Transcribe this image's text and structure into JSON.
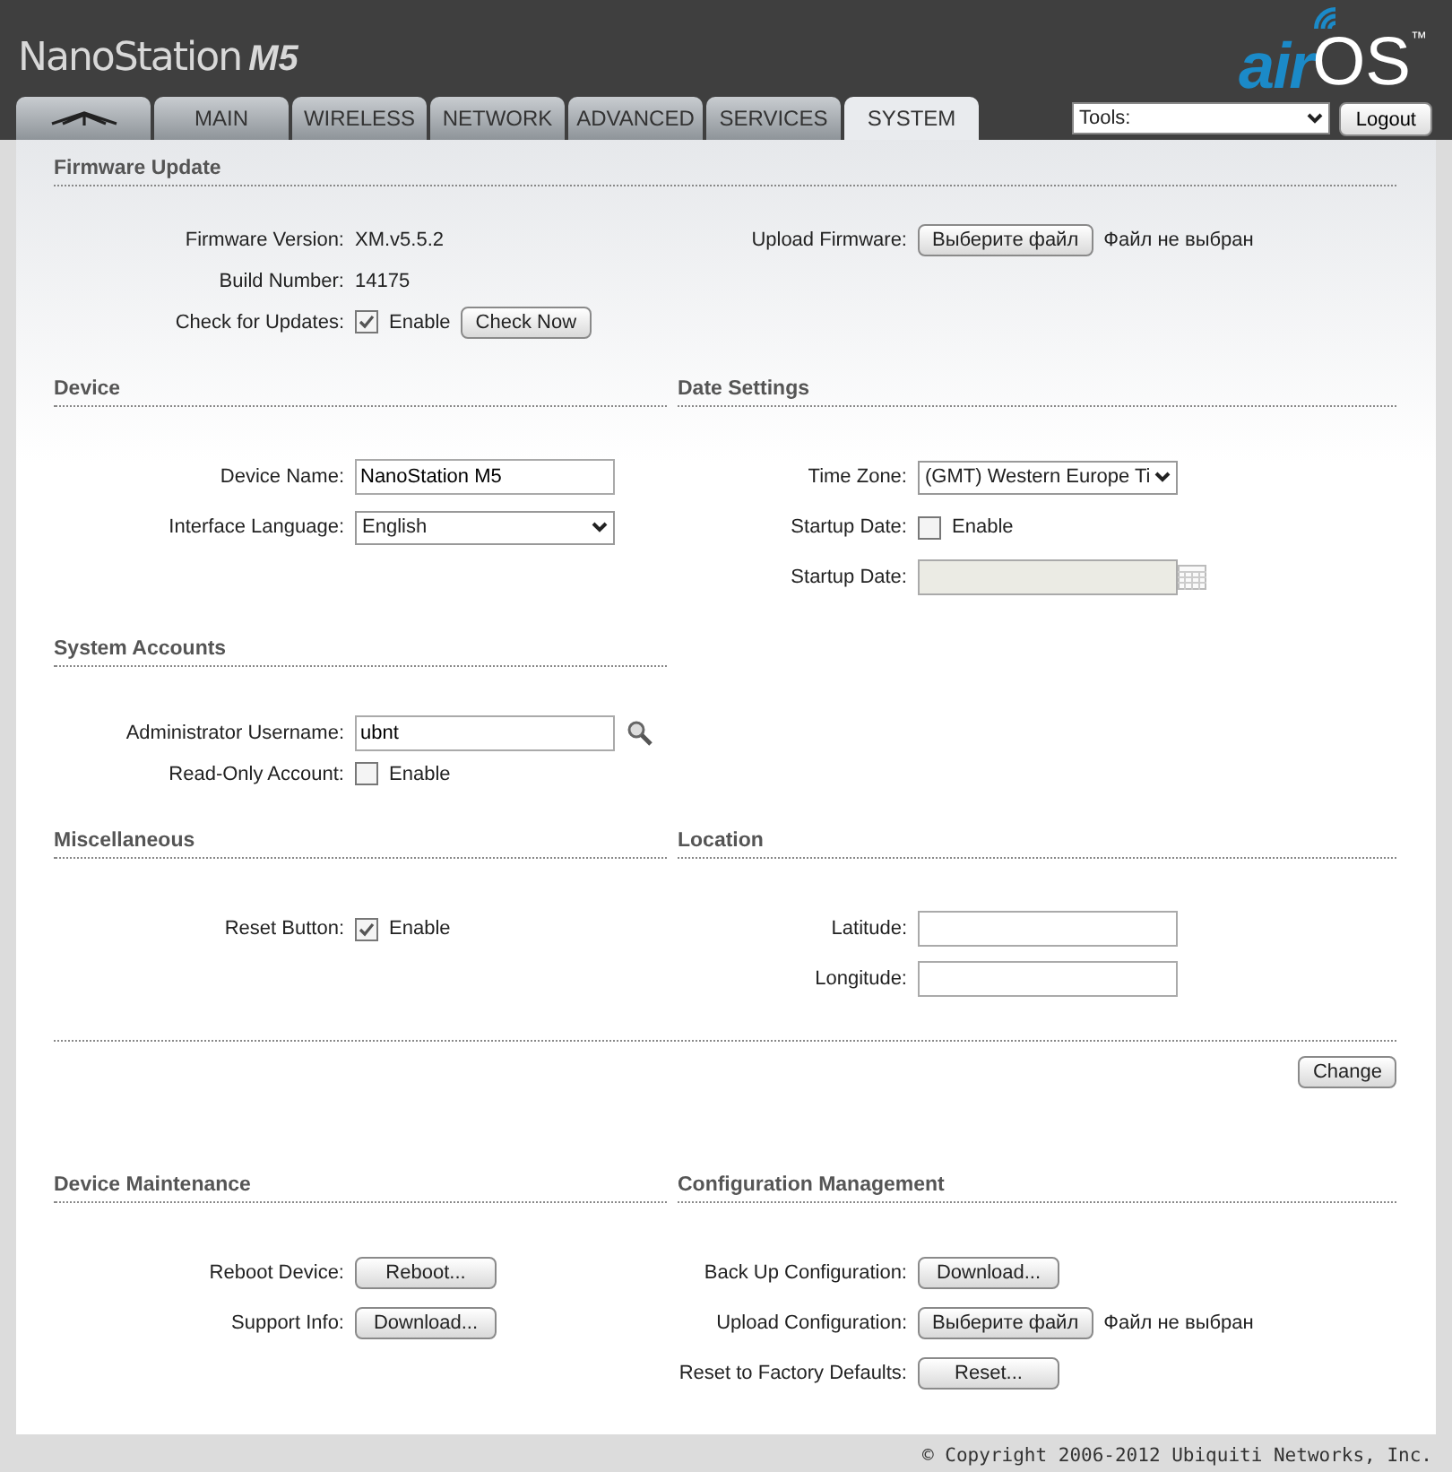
{
  "header": {
    "product": "NanoStation",
    "model": "M5",
    "logo_left": "air",
    "logo_right": "OS",
    "trademark": "™"
  },
  "tabs": [
    {
      "kind": "icon",
      "selected": false
    },
    {
      "label": "MAIN",
      "selected": false
    },
    {
      "label": "WIRELESS",
      "selected": false
    },
    {
      "label": "NETWORK",
      "selected": false
    },
    {
      "label": "ADVANCED",
      "selected": false
    },
    {
      "label": "SERVICES",
      "selected": false
    },
    {
      "label": "SYSTEM",
      "selected": true
    }
  ],
  "tools": {
    "value": "Tools:"
  },
  "logout": "Logout",
  "blocks": [
    {
      "title": "Firmware Update",
      "columns": [
        {
          "fields": [
            {
              "kind": "text",
              "label": "Firmware Version:",
              "value": "XM.v5.5.2"
            },
            {
              "kind": "text",
              "label": "Build Number:",
              "value": "14175"
            },
            {
              "kind": "checkbox",
              "label": "Check for Updates:",
              "checked": true,
              "text": "Enable",
              "button": "Check Now"
            }
          ]
        },
        {
          "fields": [
            {
              "kind": "file",
              "label": "Upload Firmware:",
              "button": "Выберите файл",
              "status": "Файл не выбран"
            }
          ]
        }
      ]
    },
    {
      "columns": [
        {
          "title": "Device",
          "fields": [
            {
              "kind": "input",
              "label": "Device Name:",
              "value": "NanoStation M5"
            },
            {
              "kind": "select",
              "label": "Interface Language:",
              "value": "English"
            }
          ]
        },
        {
          "title": "Date Settings",
          "fields": [
            {
              "kind": "select",
              "label": "Time Zone:",
              "value": "(GMT) Western Europe Ti"
            },
            {
              "kind": "checkbox",
              "label": "Startup Date:",
              "checked": false,
              "text": "Enable"
            },
            {
              "kind": "date",
              "label": "Startup Date:",
              "disabled": true
            }
          ]
        }
      ]
    },
    {
      "columns": [
        {
          "title": "System Accounts",
          "fields": [
            {
              "kind": "lookup",
              "label": "Administrator Username:",
              "value": "ubnt"
            },
            {
              "kind": "checkbox",
              "label": "Read-Only Account:",
              "checked": false,
              "text": "Enable"
            }
          ]
        }
      ]
    },
    {
      "columns": [
        {
          "title": "Miscellaneous",
          "fields": [
            {
              "kind": "checkbox",
              "label": "Reset Button:",
              "checked": true,
              "text": "Enable"
            }
          ]
        },
        {
          "title": "Location",
          "fields": [
            {
              "kind": "input",
              "label": "Latitude:"
            },
            {
              "kind": "input",
              "label": "Longitude:"
            }
          ]
        }
      ]
    }
  ],
  "change": "Change",
  "maintenance": {
    "columns": [
      {
        "title": "Device Maintenance",
        "fields": [
          {
            "kind": "button",
            "label": "Reboot Device:",
            "button": "Reboot..."
          },
          {
            "kind": "button",
            "label": "Support Info:",
            "button": "Download..."
          }
        ]
      },
      {
        "title": "Configuration Management",
        "fields": [
          {
            "kind": "button",
            "label": "Back Up Configuration:",
            "button": "Download..."
          },
          {
            "kind": "file",
            "label": "Upload Configuration:",
            "button": "Выберите файл",
            "status": "Файл не выбран"
          },
          {
            "kind": "button",
            "label": "Reset to Factory Defaults:",
            "button": "Reset..."
          }
        ]
      }
    ]
  },
  "copyright": "© Copyright 2006-2012 Ubiquiti Networks, Inc."
}
